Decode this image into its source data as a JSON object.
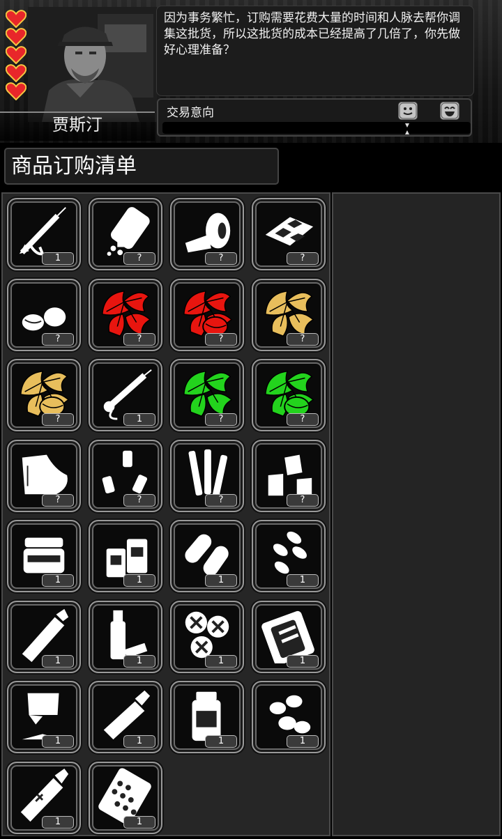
{
  "npc": {
    "name": "贾斯汀",
    "hearts": 5,
    "dialog": "因为事务繁忙，订购需要花费大量的时间和人脉去帮你调集这批货，所以这批货的成本已经提高了几倍了，你先做好心理准备？"
  },
  "trade": {
    "label": "交易意向",
    "icons": [
      "neutral-face-icon",
      "happy-face-icon"
    ]
  },
  "order": {
    "title": "商品订购清单",
    "items": [
      {
        "icon": "syringe-gun-icon",
        "count": "1"
      },
      {
        "icon": "pill-bottle-spill-icon",
        "count": "?"
      },
      {
        "icon": "bandage-roll-icon",
        "count": "?"
      },
      {
        "icon": "gauze-pads-icon",
        "count": "?"
      },
      {
        "icon": "seeds-icon",
        "count": "?"
      },
      {
        "icon": "red-herb-icon",
        "count": "?"
      },
      {
        "icon": "red-herb-seed-icon",
        "count": "?"
      },
      {
        "icon": "yellow-herb-icon",
        "count": "?"
      },
      {
        "icon": "yellow-herb-seed-icon",
        "count": "?"
      },
      {
        "icon": "syringe-injector-icon",
        "count": "1"
      },
      {
        "icon": "green-herb-icon",
        "count": "?"
      },
      {
        "icon": "green-herb-seed-icon",
        "count": "?"
      },
      {
        "icon": "splint-icon",
        "count": "?"
      },
      {
        "icon": "small-vials-icon",
        "count": "?"
      },
      {
        "icon": "test-tubes-icon",
        "count": "?"
      },
      {
        "icon": "spray-bottles-icon",
        "count": "?"
      },
      {
        "icon": "ointment-jar-icon",
        "count": "1"
      },
      {
        "icon": "medicine-bottles-icon",
        "count": "1"
      },
      {
        "icon": "capsules-icon",
        "count": "1"
      },
      {
        "icon": "pills-icon",
        "count": "1"
      },
      {
        "icon": "tube-ointment-icon",
        "count": "1"
      },
      {
        "icon": "dropper-bottle-icon",
        "count": "1"
      },
      {
        "icon": "cross-tablets-icon",
        "count": "1"
      },
      {
        "icon": "ampoule-box-icon",
        "count": "1"
      },
      {
        "icon": "powder-packet-icon",
        "count": "1"
      },
      {
        "icon": "gel-tube-icon",
        "count": "1"
      },
      {
        "icon": "medicine-jar-icon",
        "count": "1"
      },
      {
        "icon": "tablets-icon",
        "count": "1"
      },
      {
        "icon": "cream-tube-icon",
        "count": "1"
      },
      {
        "icon": "blister-pack-icon",
        "count": "1"
      }
    ]
  },
  "colors": {
    "red_herb": "#e8150f",
    "yellow_herb": "#e8be5c",
    "green_herb": "#23d31d",
    "heart": "#e8262a"
  }
}
